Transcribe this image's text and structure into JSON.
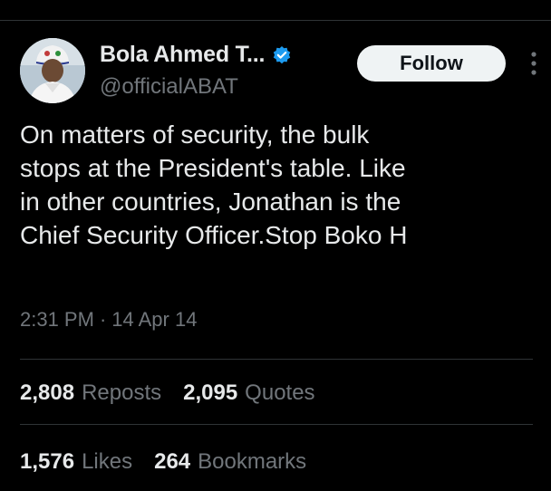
{
  "author": {
    "display_name": "Bola Ahmed T...",
    "handle": "@officialABAT",
    "verified": true
  },
  "follow_button": {
    "label": "Follow"
  },
  "tweet": {
    "text": "On matters of security, the bulk\nstops at the President's table. Like\nin other countries, Jonathan is the\nChief Security Officer.Stop Boko H",
    "time": "2:31 PM",
    "separator": "·",
    "date": "14 Apr 14"
  },
  "stats": {
    "reposts": {
      "count": "2,808",
      "label": "Reposts"
    },
    "quotes": {
      "count": "2,095",
      "label": "Quotes"
    },
    "likes": {
      "count": "1,576",
      "label": "Likes"
    },
    "bookmarks": {
      "count": "264",
      "label": "Bookmarks"
    }
  },
  "colors": {
    "background": "#000000",
    "text_primary": "#e7e9ea",
    "text_secondary": "#71767b",
    "divider": "#2f3336",
    "verified_badge": "#1d9bf0",
    "follow_bg": "#eff3f4"
  },
  "icons": {
    "verified": "verified-badge-icon",
    "more": "more-vertical-icon",
    "avatar": "profile-photo"
  }
}
